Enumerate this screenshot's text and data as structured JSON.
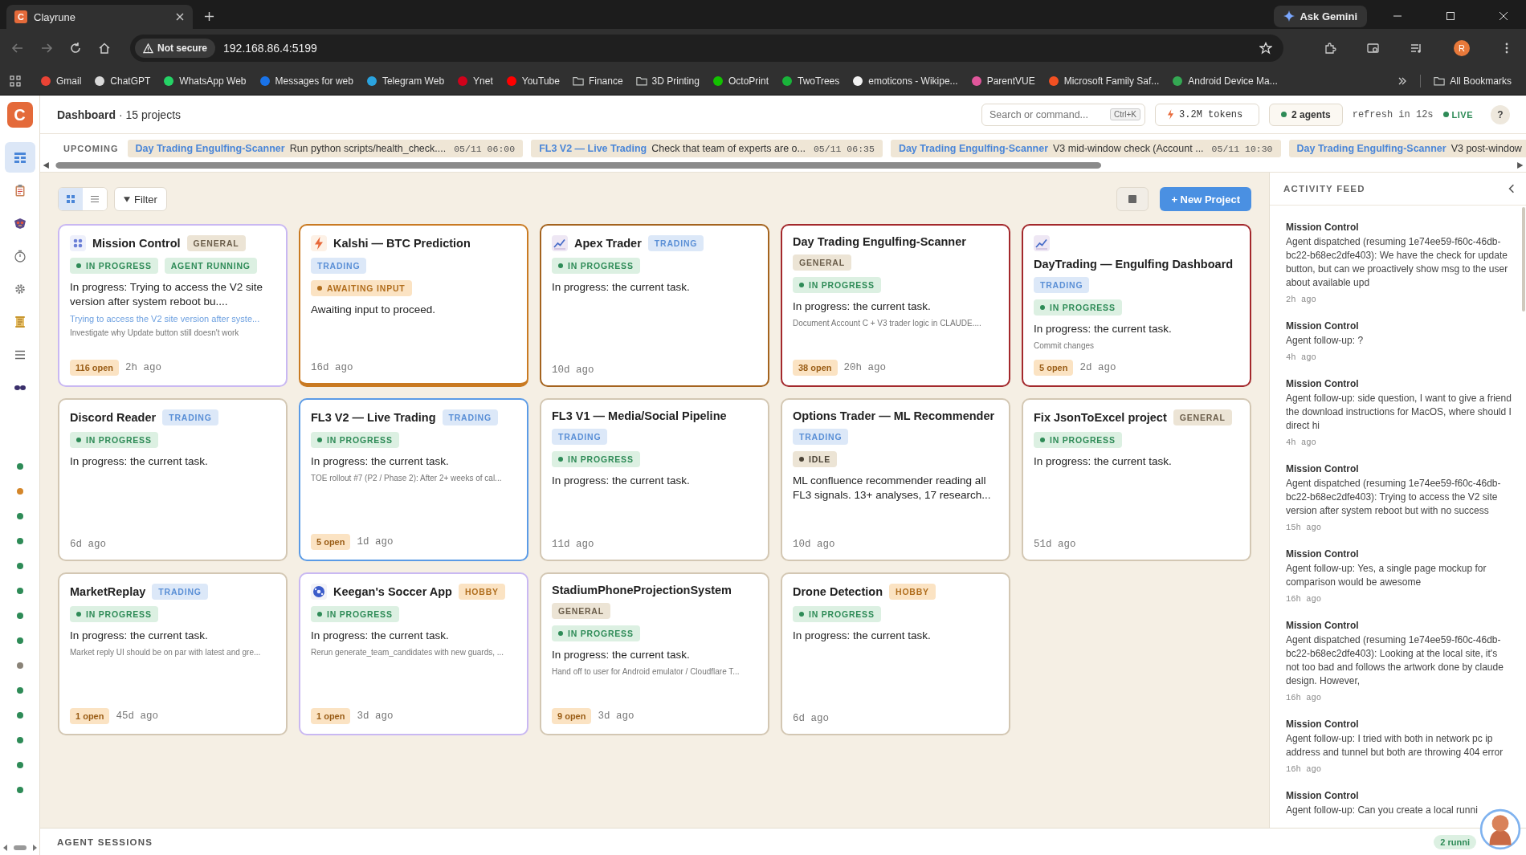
{
  "browser": {
    "tab": {
      "favicon_letter": "C",
      "title": "Clayrune"
    },
    "assistant_button": "Ask Gemini",
    "security": "Not secure",
    "url": "192.168.86.4:5199",
    "profile": "R",
    "bookmarks": [
      {
        "label": "Gmail",
        "kind": "site",
        "color": "#ea4335"
      },
      {
        "label": "ChatGPT",
        "kind": "site",
        "color": "#d9d9d9"
      },
      {
        "label": "WhatsApp Web",
        "kind": "site",
        "color": "#25d366"
      },
      {
        "label": "Messages for web",
        "kind": "site",
        "color": "#1a73e8"
      },
      {
        "label": "Telegram Web",
        "kind": "site",
        "color": "#2aa3df"
      },
      {
        "label": "Ynet",
        "kind": "site",
        "color": "#d0021b"
      },
      {
        "label": "YouTube",
        "kind": "site",
        "color": "#ff0000"
      },
      {
        "label": "Finance",
        "kind": "folder"
      },
      {
        "label": "3D Printing",
        "kind": "folder"
      },
      {
        "label": "OctoPrint",
        "kind": "site",
        "color": "#13c100"
      },
      {
        "label": "TwoTrees",
        "kind": "site",
        "color": "#19b33a"
      },
      {
        "label": "emoticons - Wikipe...",
        "kind": "site",
        "color": "#f1f1f1"
      },
      {
        "label": "ParentVUE",
        "kind": "site",
        "color": "#e0569b"
      },
      {
        "label": "Microsoft Family Saf...",
        "kind": "site",
        "color": "#f25022"
      },
      {
        "label": "Android Device Ma...",
        "kind": "site",
        "color": "#34a853"
      }
    ],
    "all_bookmarks": "All Bookmarks"
  },
  "app": {
    "logo": "C",
    "sidebar": {
      "nav": [
        {
          "kind": "grid",
          "selected": true
        },
        {
          "kind": "clipboard",
          "selected": false
        },
        {
          "kind": "emblem",
          "selected": false
        },
        {
          "kind": "timer",
          "selected": false
        },
        {
          "kind": "gear",
          "selected": false
        },
        {
          "kind": "scroll",
          "selected": false
        },
        {
          "kind": "list",
          "selected": false
        },
        {
          "kind": "goggles",
          "selected": false
        }
      ],
      "project_dots": [
        {
          "color": "#2e8b57"
        },
        {
          "color": "#d4862a"
        },
        {
          "color": "#2e8b57"
        },
        {
          "color": "#2e8b57"
        },
        {
          "color": "#2e8b57"
        },
        {
          "color": "#2e8b57"
        },
        {
          "color": "#2e8b57"
        },
        {
          "color": "#2e8b57"
        },
        {
          "color": "#8a8378"
        },
        {
          "color": "#2e8b57"
        },
        {
          "color": "#2e8b57"
        },
        {
          "color": "#2e8b57"
        },
        {
          "color": "#2e8b57"
        },
        {
          "color": "#2e8b57"
        }
      ]
    },
    "header": {
      "title": "**Dashboard** · 15 projects",
      "search": {
        "placeholder": "Search or command...",
        "shortcut": "Ctrl+K"
      },
      "tokens": "3.2M tokens",
      "agents": "2 agents",
      "refresh": "refresh in 12s",
      "live": "LIVE",
      "help": "?"
    },
    "upcoming": {
      "label": "UPCOMING",
      "items": [
        {
          "project": "Day Trading Engulfing-Scanner",
          "text": "Run python scripts/health_check....",
          "time": "05/11 06:00"
        },
        {
          "project": "FL3 V2 — Live Trading",
          "text": "Check that team of experts are o...",
          "time": "05/11 06:35"
        },
        {
          "project": "Day Trading Engulfing-Scanner",
          "text": "V3 mid-window check (Account ...",
          "time": "05/11 10:30"
        },
        {
          "project": "Day Trading Engulfing-Scanner",
          "text": "V3 post-window"
        }
      ]
    },
    "toolbar": {
      "views": [
        {
          "kind": "grid",
          "selected": true
        },
        {
          "kind": "list",
          "selected": false
        }
      ],
      "filter": "Filter",
      "new_project": "+ New Project"
    },
    "projects": [
      {
        "name": "Mission Control",
        "tag": {
          "label": "GENERAL",
          "kind": "general"
        },
        "statuses": [
          {
            "label": "IN PROGRESS",
            "kind": "progress"
          },
          {
            "label": "AGENT RUNNING",
            "kind": "running"
          }
        ],
        "summary": "In progress: Trying to access the V2 site version after system reboot bu....",
        "link": "Trying to access the V2 site version after syste...",
        "note": "Investigate why Update button still doesn't work",
        "open": "116 open",
        "age": "2h ago",
        "color": "#c9b8f2"
      },
      {
        "name": "Kalshi — BTC Prediction",
        "tag": {
          "label": "TRADING",
          "kind": "trading"
        },
        "statuses": [
          {
            "label": "AWAITING INPUT",
            "kind": "awaiting"
          }
        ],
        "summary": "Awaiting input to proceed.",
        "age": "16d ago",
        "color": "#c97a22"
      },
      {
        "name": "Apex Trader",
        "tag": {
          "label": "TRADING",
          "kind": "trading"
        },
        "statuses": [
          {
            "label": "IN PROGRESS",
            "kind": "progress"
          }
        ],
        "summary": "In progress: the current task.",
        "age": "10d ago",
        "color": "#a4631e"
      },
      {
        "name": "Day Trading Engulfing-Scanner",
        "tag": {
          "label": "GENERAL",
          "kind": "general"
        },
        "statuses": [
          {
            "label": "IN PROGRESS",
            "kind": "progress"
          }
        ],
        "summary": "In progress: the current task.",
        "note": "Document Account C + V3 trader logic in CLAUDE....",
        "open": "38 open",
        "age": "20h ago",
        "color": "#a3282c"
      },
      {
        "name": "DayTrading — Engulfing Dashboard",
        "tag": {
          "label": "TRADING",
          "kind": "trading"
        },
        "statuses": [
          {
            "label": "IN PROGRESS",
            "kind": "progress"
          }
        ],
        "summary": "In progress: the current task.",
        "note": "Commit changes",
        "open": "5 open",
        "age": "2d ago",
        "color": "#a3282c"
      },
      {
        "name": "Discord Reader",
        "tag": {
          "label": "TRADING",
          "kind": "trading"
        },
        "statuses": [
          {
            "label": "IN PROGRESS",
            "kind": "progress"
          }
        ],
        "summary": "In progress: the current task.",
        "age": "6d ago",
        "color": "#d3c7b3"
      },
      {
        "name": "FL3 V2 — Live Trading",
        "tag": {
          "label": "TRADING",
          "kind": "trading"
        },
        "statuses": [
          {
            "label": "IN PROGRESS",
            "kind": "progress"
          }
        ],
        "summary": "In progress: the current task.",
        "note": "TOE rollout #7 (P2 / Phase 2): After 2+ weeks of cal...",
        "open": "5 open",
        "age": "1d ago",
        "color": "#5b9be6"
      },
      {
        "name": "FL3 V1 — Media/Social Pipeline",
        "tag": {
          "label": "TRADING",
          "kind": "trading"
        },
        "statuses": [
          {
            "label": "IN PROGRESS",
            "kind": "progress"
          }
        ],
        "summary": "In progress: the current task.",
        "age": "11d ago",
        "color": "#d3c7b3"
      },
      {
        "name": "Options Trader — ML Recommender",
        "tag": {
          "label": "TRADING",
          "kind": "trading"
        },
        "statuses": [
          {
            "label": "IDLE",
            "kind": "idle"
          }
        ],
        "summary": "ML confluence recommender reading all FL3 signals. 13+ analyses, 17 research...",
        "age": "10d ago",
        "color": "#d3c7b3"
      },
      {
        "name": "Fix JsonToExcel project",
        "tag": {
          "label": "GENERAL",
          "kind": "general"
        },
        "statuses": [
          {
            "label": "IN PROGRESS",
            "kind": "progress"
          }
        ],
        "summary": "In progress: the current task.",
        "age": "51d ago",
        "color": "#d3c7b3"
      },
      {
        "name": "MarketReplay",
        "tag": {
          "label": "TRADING",
          "kind": "trading"
        },
        "statuses": [
          {
            "label": "IN PROGRESS",
            "kind": "progress"
          }
        ],
        "summary": "In progress: the current task.",
        "note": "Market reply UI should be on par with latest and gre...",
        "open": "1 open",
        "age": "45d ago",
        "color": "#d3c7b3"
      },
      {
        "name": "Keegan's Soccer App",
        "tag": {
          "label": "HOBBY",
          "kind": "hobby"
        },
        "statuses": [
          {
            "label": "IN PROGRESS",
            "kind": "progress"
          }
        ],
        "summary": "In progress: the current task.",
        "note": "Rerun generate_team_candidates with new guards, ...",
        "open": "1 open",
        "age": "3d ago",
        "color": "#c9b8f2"
      },
      {
        "name": "StadiumPhoneProjectionSystem",
        "tag": {
          "label": "GENERAL",
          "kind": "general"
        },
        "statuses": [
          {
            "label": "IN PROGRESS",
            "kind": "progress"
          }
        ],
        "summary": "In progress: the current task.",
        "note": "Hand off to user for Android emulator / Cloudflare T...",
        "open": "9 open",
        "age": "3d ago",
        "color": "#d3c7b3"
      },
      {
        "name": "Drone Detection",
        "tag": {
          "label": "HOBBY",
          "kind": "hobby"
        },
        "statuses": [
          {
            "label": "IN PROGRESS",
            "kind": "progress"
          }
        ],
        "summary": "In progress: the current task.",
        "age": "6d ago",
        "color": "#d3c7b3"
      }
    ],
    "activity_feed": {
      "title": "ACTIVITY FEED",
      "items": [
        {
          "project": "Mission Control",
          "text": "Agent dispatched (resuming 1e74ee59-f60c-46db-bc22-b68ec2dfe403): We have the check for update button, but can we proactively show msg to the user about available upd",
          "age": "2h ago"
        },
        {
          "project": "Mission Control",
          "text": "Agent follow-up: ?",
          "age": "4h ago"
        },
        {
          "project": "Mission Control",
          "text": "Agent follow-up: side question, I want to give a friend the download instructions for MacOS, where should I direct hi",
          "age": "4h ago"
        },
        {
          "project": "Mission Control",
          "text": "Agent dispatched (resuming 1e74ee59-f60c-46db-bc22-b68ec2dfe403): Trying to access the V2 site version after system reboot but with no success",
          "age": "15h ago"
        },
        {
          "project": "Mission Control",
          "text": "Agent follow-up: Yes, a single page mockup for comparison would be awesome",
          "age": "16h ago"
        },
        {
          "project": "Mission Control",
          "text": "Agent dispatched (resuming 1e74ee59-f60c-46db-bc22-b68ec2dfe403): Looking at the local site, it's not too bad and follows the artwork done by claude design. However,",
          "age": "16h ago"
        },
        {
          "project": "Mission Control",
          "text": "Agent follow-up: I tried with both in network pc ip address and tunnel but both are throwing 404 error",
          "age": "16h ago"
        },
        {
          "project": "Mission Control",
          "text": "Agent follow-up: Can you create a local runni"
        }
      ]
    },
    "agent_sessions": {
      "title": "AGENT SESSIONS",
      "running": "2 runni"
    }
  }
}
